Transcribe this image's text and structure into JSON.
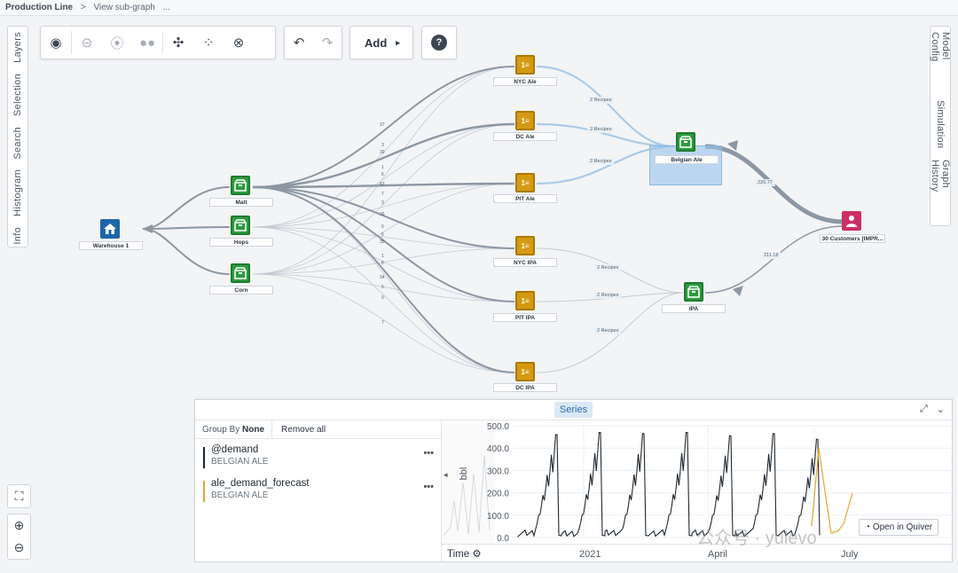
{
  "breadcrumb": {
    "root": "Production Line",
    "sep": ">",
    "current": "View sub-graph",
    "more": "..."
  },
  "toolbar": {
    "add_label": "Add",
    "add_caret": "▸",
    "help": "?"
  },
  "left_tabs": [
    "Info",
    "Histogram",
    "Search",
    "Selection",
    "Layers"
  ],
  "right_tabs": [
    "Model Config",
    "Simulation",
    "Graph History"
  ],
  "nodes": {
    "warehouse": "Warehouse 1",
    "malt": "Malt",
    "hops": "Hops",
    "corn": "Corn",
    "nyc_ale": "NYC Ale",
    "dc_ale": "DC Ale",
    "pit_ale": "PIT Ale",
    "nyc_ipa": "NYC IPA",
    "pit_ipa": "PIT IPA",
    "dc_ipa": "DC IPA",
    "belgian_ale": "Belgian Ale",
    "ipa": "IPA",
    "customers": "30 Customers [IMPR..."
  },
  "edge_labels": {
    "r1": "2 Recipes",
    "r2": "2 Recipes",
    "r3": "2 Recipes",
    "r4": "2 Recipes",
    "r5": "2 Recipes",
    "r6": "2 Recipes",
    "belgian_flow": "220.77",
    "ipa_flow": "211.18"
  },
  "edge_numbers": [
    "37",
    "3",
    "39",
    "1",
    "6",
    "43",
    "7",
    "3",
    "36",
    "6",
    "6",
    "35",
    "1",
    "8",
    "34",
    "5",
    "9",
    "7"
  ],
  "panel": {
    "tab": "Series",
    "group_by_label": "Group By",
    "group_by_value": "None",
    "remove_all": "Remove all",
    "series": [
      {
        "name": "@demand",
        "sub": "BELGIAN ALE",
        "color": "#1f2830",
        "menu": "•••"
      },
      {
        "name": "ale_demand_forecast",
        "sub": "BELGIAN ALE",
        "color": "#e8a431",
        "menu": "•••"
      }
    ],
    "time_label": "Time",
    "open_in_quiver": "Open in Quiver"
  },
  "chart_data": {
    "type": "line",
    "ylabel": "bbl",
    "yticks": [
      "500.0",
      "400.0",
      "300.0",
      "200.0",
      "100.0",
      "0.0"
    ],
    "ylim": [
      0,
      500
    ],
    "xticks": [
      "2021",
      "April",
      "July"
    ],
    "series": [
      {
        "name": "@demand",
        "color": "#1f2830",
        "peaks": [
          460,
          470,
          465,
          470,
          455,
          465,
          440
        ]
      },
      {
        "name": "ale_demand_forecast",
        "color": "#e8a431",
        "peaks": [
          400,
          200
        ]
      }
    ]
  },
  "watermark": "公众号 · yulevo"
}
